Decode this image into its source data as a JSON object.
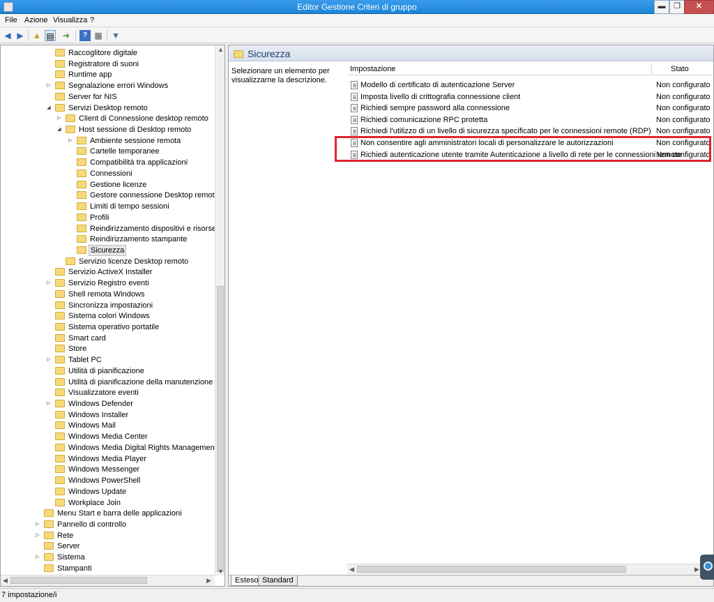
{
  "window": {
    "title": "Editor Gestione Criteri di gruppo",
    "min_label": "▬",
    "max_label": "❐",
    "close_label": "✕"
  },
  "menu": [
    "File",
    "Azione",
    "Visualizza",
    "?"
  ],
  "toolbar": {
    "icons": [
      "back-arrow-icon",
      "forward-arrow-icon",
      "up-folder-icon",
      "show-hide-tree-icon",
      "export-list-icon",
      "help-icon",
      "properties-icon",
      "filter-icon"
    ]
  },
  "tree": {
    "items": [
      {
        "label": "Raccoglitore digitale",
        "level": 3,
        "exp": ""
      },
      {
        "label": "Registratore di suoni",
        "level": 3,
        "exp": ""
      },
      {
        "label": "Runtime app",
        "level": 3,
        "exp": ""
      },
      {
        "label": "Segnalazione errori Windows",
        "level": 3,
        "exp": "▷"
      },
      {
        "label": "Server for NIS",
        "level": 3,
        "exp": ""
      },
      {
        "label": "Servizi Desktop remoto",
        "level": 3,
        "exp": "◢"
      },
      {
        "label": "Client di Connessione desktop remoto",
        "level": 4,
        "exp": "▷"
      },
      {
        "label": "Host sessione di Desktop remoto",
        "level": 4,
        "exp": "◢"
      },
      {
        "label": "Ambiente sessione remota",
        "level": 5,
        "exp": "▷"
      },
      {
        "label": "Cartelle temporanee",
        "level": 5,
        "exp": ""
      },
      {
        "label": "Compatibilità tra applicazioni",
        "level": 5,
        "exp": ""
      },
      {
        "label": "Connessioni",
        "level": 5,
        "exp": ""
      },
      {
        "label": "Gestione licenze",
        "level": 5,
        "exp": ""
      },
      {
        "label": "Gestore connessione Desktop remoto",
        "level": 5,
        "exp": ""
      },
      {
        "label": "Limiti di tempo sessioni",
        "level": 5,
        "exp": ""
      },
      {
        "label": "Profili",
        "level": 5,
        "exp": ""
      },
      {
        "label": "Reindirizzamento dispositivi e risorse",
        "level": 5,
        "exp": ""
      },
      {
        "label": "Reindirizzamento stampante",
        "level": 5,
        "exp": ""
      },
      {
        "label": "Sicurezza",
        "level": 5,
        "exp": "",
        "selected": true
      },
      {
        "label": "Servizio licenze Desktop remoto",
        "level": 4,
        "exp": ""
      },
      {
        "label": "Servizio ActiveX Installer",
        "level": 3,
        "exp": ""
      },
      {
        "label": "Servizio Registro eventi",
        "level": 3,
        "exp": "▷"
      },
      {
        "label": "Shell remota Windows",
        "level": 3,
        "exp": ""
      },
      {
        "label": "Sincronizza impostazioni",
        "level": 3,
        "exp": ""
      },
      {
        "label": "Sistema colori Windows",
        "level": 3,
        "exp": ""
      },
      {
        "label": "Sistema operativo portatile",
        "level": 3,
        "exp": ""
      },
      {
        "label": "Smart card",
        "level": 3,
        "exp": ""
      },
      {
        "label": "Store",
        "level": 3,
        "exp": ""
      },
      {
        "label": "Tablet PC",
        "level": 3,
        "exp": "▷"
      },
      {
        "label": "Utilità di pianificazione",
        "level": 3,
        "exp": ""
      },
      {
        "label": "Utilità di pianificazione della manutenzione",
        "level": 3,
        "exp": ""
      },
      {
        "label": "Visualizzatore eventi",
        "level": 3,
        "exp": ""
      },
      {
        "label": "Windows Defender",
        "level": 3,
        "exp": "▷"
      },
      {
        "label": "Windows Installer",
        "level": 3,
        "exp": ""
      },
      {
        "label": "Windows Mail",
        "level": 3,
        "exp": ""
      },
      {
        "label": "Windows Media Center",
        "level": 3,
        "exp": ""
      },
      {
        "label": "Windows Media Digital Rights Management",
        "level": 3,
        "exp": ""
      },
      {
        "label": "Windows Media Player",
        "level": 3,
        "exp": ""
      },
      {
        "label": "Windows Messenger",
        "level": 3,
        "exp": ""
      },
      {
        "label": "Windows PowerShell",
        "level": 3,
        "exp": ""
      },
      {
        "label": "Windows Update",
        "level": 3,
        "exp": ""
      },
      {
        "label": "Workplace Join",
        "level": 3,
        "exp": ""
      },
      {
        "label": "Menu Start e barra delle applicazioni",
        "level": 2,
        "exp": ""
      },
      {
        "label": "Pannello di controllo",
        "level": 2,
        "exp": "▷"
      },
      {
        "label": "Rete",
        "level": 2,
        "exp": "▷"
      },
      {
        "label": "Server",
        "level": 2,
        "exp": ""
      },
      {
        "label": "Sistema",
        "level": 2,
        "exp": "▷"
      },
      {
        "label": "Stampanti",
        "level": 2,
        "exp": ""
      }
    ]
  },
  "right": {
    "title": "Sicurezza",
    "description": "Selezionare un elemento per visualizzarne la descrizione.",
    "columns": {
      "setting": "Impostazione",
      "state": "Stato"
    },
    "rows": [
      {
        "name": "Modello di certificato di autenticazione Server",
        "state": "Non configurato"
      },
      {
        "name": "Imposta livello di crittografia connessione client",
        "state": "Non configurato"
      },
      {
        "name": "Richiedi sempre password alla connessione",
        "state": "Non configurato"
      },
      {
        "name": "Richiedi comunicazione RPC protetta",
        "state": "Non configurato"
      },
      {
        "name": "Richiedi l'utilizzo di un livello di sicurezza specificato per le connessioni remote (RDP)",
        "state": "Non configurato"
      },
      {
        "name": "Non consentire agli amministratori locali di personalizzare le autorizzazioni",
        "state": "Non configurato"
      },
      {
        "name": "Richiedi autenticazione utente tramite Autenticazione a livello di rete per le connessioni remote",
        "state": "Non configurato"
      }
    ],
    "tabs": [
      "Esteso",
      "Standard"
    ]
  },
  "status": "7 impostazione/i"
}
